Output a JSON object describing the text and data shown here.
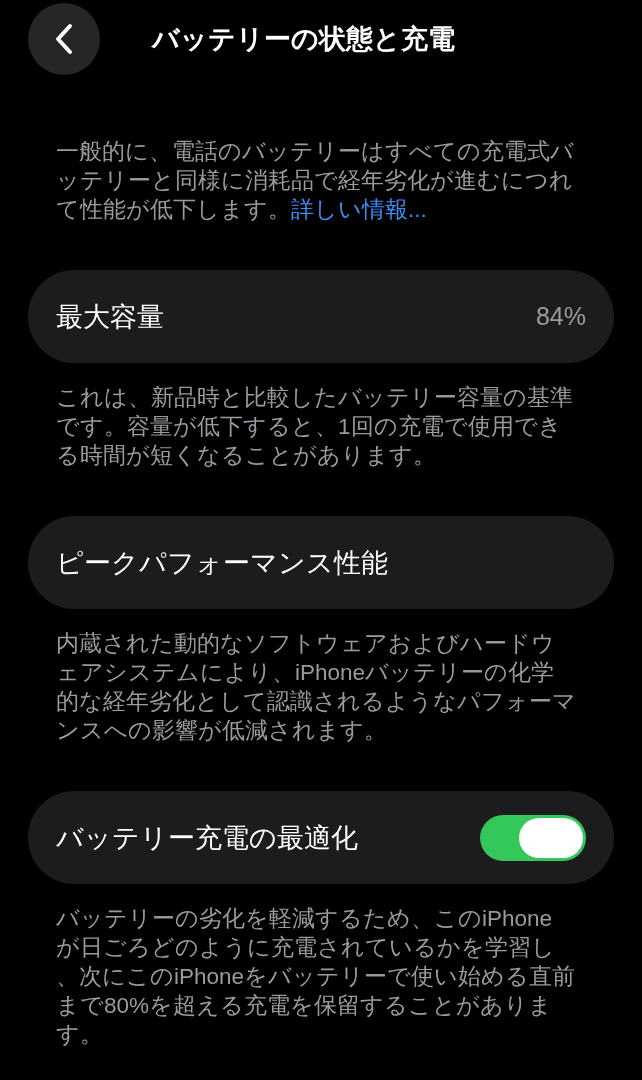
{
  "header": {
    "title": "バッテリーの状態と充電"
  },
  "intro": {
    "text": "一般的に、電話のバッテリーはすべての充電式バッテリーと同様に消耗品で経年劣化が進むにつれて性能が低下します。",
    "link": "詳しい情報..."
  },
  "sections": [
    {
      "kind": "value",
      "label": "最大容量",
      "value": "84%",
      "note": "これは、新品時と比較したバッテリー容量の基準です。容量が低下すると、1回の充電で使用できる時間が短くなることがあります。"
    },
    {
      "kind": "plain",
      "label": "ピークパフォーマンス性能",
      "note": "内蔵された動的なソフトウェアおよびハードウェアシステムにより、iPhoneバッテリーの化学的な経年劣化として認識されるようなパフォーマンスへの影響が低減されます。"
    },
    {
      "kind": "toggle",
      "label": "バッテリー充電の最適化",
      "on": true,
      "note": "バッテリーの劣化を軽減するため、このiPhoneが日ごろどのように充電されているかを学習し、次にこのiPhoneをバッテリーで使い始める直前まで80%を超える充電を保留することがあります。"
    }
  ]
}
